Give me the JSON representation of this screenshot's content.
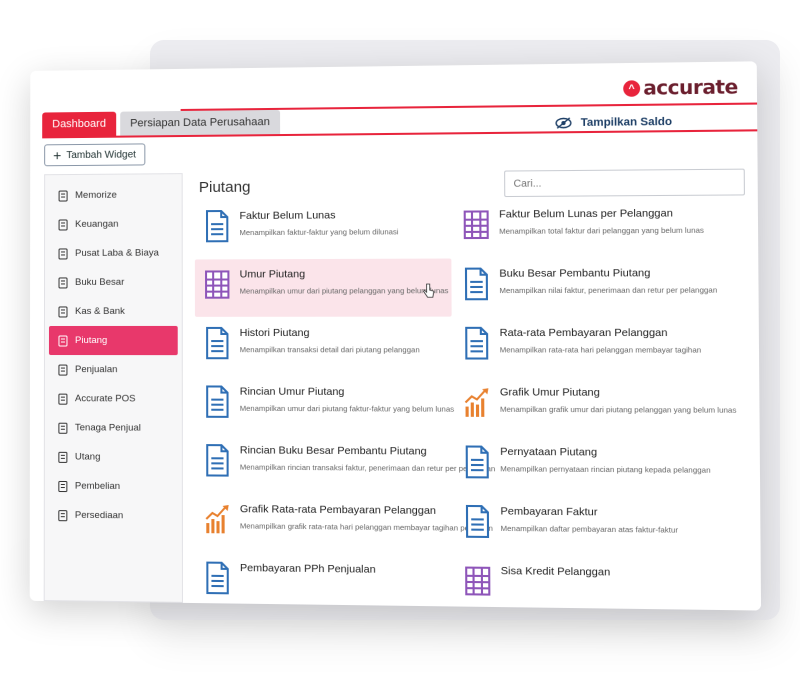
{
  "brand": {
    "name": "accurate"
  },
  "tabs": [
    {
      "label": "Dashboard",
      "active": true
    },
    {
      "label": "Persiapan Data Perusahaan",
      "active": false
    }
  ],
  "header": {
    "show_balance_label": "Tampilkan Saldo"
  },
  "toolbar": {
    "add_widget_label": "Tambah Widget"
  },
  "sidebar": {
    "items": [
      {
        "label": "Memorize",
        "icon": "bookmark-icon"
      },
      {
        "label": "Keuangan",
        "icon": "wallet-icon"
      },
      {
        "label": "Pusat Laba & Biaya",
        "icon": "document-icon"
      },
      {
        "label": "Buku Besar",
        "icon": "book-icon"
      },
      {
        "label": "Kas & Bank",
        "icon": "bank-icon"
      },
      {
        "label": "Piutang",
        "icon": "receivable-icon",
        "active": true
      },
      {
        "label": "Penjualan",
        "icon": "cart-icon"
      },
      {
        "label": "Accurate POS",
        "icon": "pos-icon"
      },
      {
        "label": "Tenaga Penjual",
        "icon": "person-icon"
      },
      {
        "label": "Utang",
        "icon": "payable-icon"
      },
      {
        "label": "Pembelian",
        "icon": "bag-icon"
      },
      {
        "label": "Persediaan",
        "icon": "inventory-icon"
      }
    ]
  },
  "main": {
    "title": "Piutang",
    "search_placeholder": "Cari...",
    "left_cards": [
      {
        "title": "Faktur Belum Lunas",
        "desc": "Menampilkan faktur-faktur yang belum dilunasi",
        "icon": "document-icon"
      },
      {
        "title": "Umur Piutang",
        "desc": "Menampilkan umur dari piutang pelanggan yang belum lunas",
        "icon": "table-icon",
        "highlight": true
      },
      {
        "title": "Histori Piutang",
        "desc": "Menampilkan transaksi detail dari piutang pelanggan",
        "icon": "document-icon"
      },
      {
        "title": "Rincian Umur Piutang",
        "desc": "Menampilkan umur dari piutang faktur-faktur yang belum lunas",
        "icon": "document-icon"
      },
      {
        "title": "Rincian Buku Besar Pembantu Piutang",
        "desc": "Menampilkan rincian transaksi faktur, penerimaan dan retur per pelanggan",
        "icon": "document-icon"
      },
      {
        "title": "Grafik Rata-rata Pembayaran Pelanggan",
        "desc": "Menampilkan grafik rata-rata hari pelanggan membayar tagihan per bulan",
        "icon": "chart-icon"
      },
      {
        "title": "Pembayaran PPh Penjualan",
        "desc": "",
        "icon": "document-icon"
      }
    ],
    "right_cards": [
      {
        "title": "Faktur Belum Lunas per Pelanggan",
        "desc": "Menampilkan total faktur dari pelanggan yang belum lunas",
        "icon": "table-icon"
      },
      {
        "title": "Buku Besar Pembantu Piutang",
        "desc": "Menampilkan nilai faktur, penerimaan dan retur per pelanggan",
        "icon": "document-icon"
      },
      {
        "title": "Rata-rata Pembayaran Pelanggan",
        "desc": "Menampilkan rata-rata hari pelanggan membayar tagihan",
        "icon": "document-icon"
      },
      {
        "title": "Grafik Umur Piutang",
        "desc": "Menampilkan grafik umur dari piutang pelanggan yang belum lunas",
        "icon": "chart-icon"
      },
      {
        "title": "Pernyataan Piutang",
        "desc": "Menampilkan pernyataan rincian piutang kepada pelanggan",
        "icon": "document-icon"
      },
      {
        "title": "Pembayaran Faktur",
        "desc": "Menampilkan daftar pembayaran atas faktur-faktur",
        "icon": "document-icon"
      },
      {
        "title": "Sisa Kredit Pelanggan",
        "desc": "",
        "icon": "table-icon"
      }
    ]
  },
  "colors": {
    "accent": "#e8243c",
    "active_side": "#e8386b",
    "icon_blue": "#2f6fb5",
    "icon_purple": "#8e55b9",
    "icon_orange": "#e8812f"
  }
}
